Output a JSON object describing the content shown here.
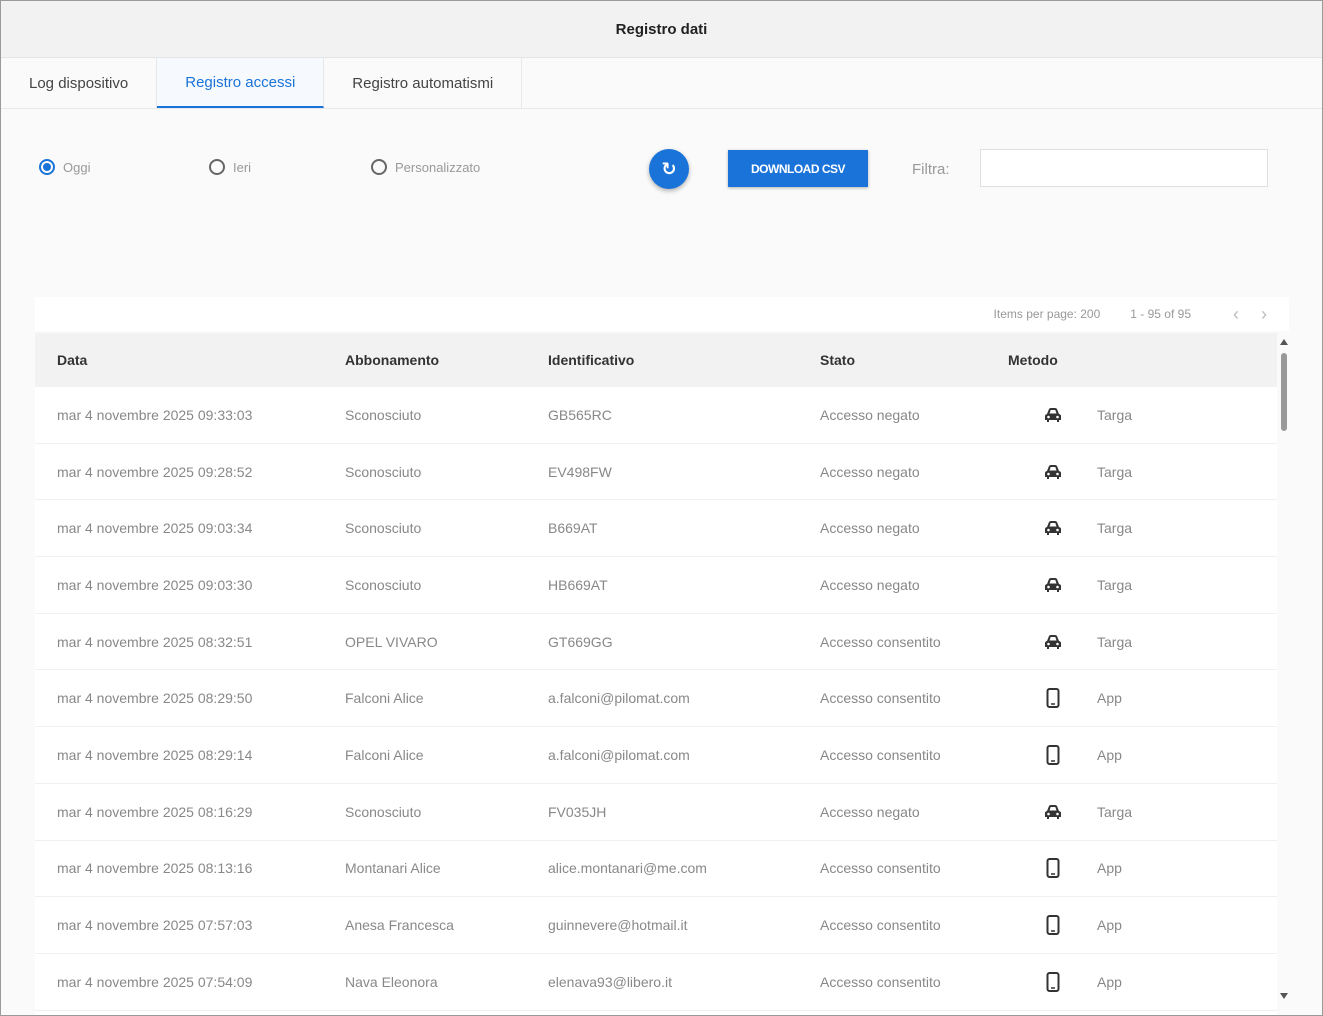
{
  "window": {
    "title": "Registro dati"
  },
  "tabs": [
    {
      "label": "Log dispositivo",
      "active": false
    },
    {
      "label": "Registro accessi",
      "active": true
    },
    {
      "label": "Registro automatismi",
      "active": false
    }
  ],
  "filters": {
    "radios": [
      {
        "label": "Oggi",
        "checked": true
      },
      {
        "label": "Ieri",
        "checked": false
      },
      {
        "label": "Personalizzato",
        "checked": false
      }
    ],
    "download_label": "DOWNLOAD CSV",
    "filter_label": "Filtra:",
    "filter_value": ""
  },
  "pager": {
    "items_per_page": "Items per page: 200",
    "range": "1 - 95 of 95"
  },
  "table": {
    "headers": [
      "Data",
      "Abbonamento",
      "Identificativo",
      "Stato",
      "Metodo"
    ],
    "rows": [
      {
        "data": "mar 4 novembre 2025 09:33:03",
        "abbonamento": "Sconosciuto",
        "identificativo": "GB565RC",
        "stato": "Accesso negato",
        "icon": "car-icon",
        "metodo": "Targa"
      },
      {
        "data": "mar 4 novembre 2025 09:28:52",
        "abbonamento": "Sconosciuto",
        "identificativo": "EV498FW",
        "stato": "Accesso negato",
        "icon": "car-icon",
        "metodo": "Targa"
      },
      {
        "data": "mar 4 novembre 2025 09:03:34",
        "abbonamento": "Sconosciuto",
        "identificativo": "B669AT",
        "stato": "Accesso negato",
        "icon": "car-icon",
        "metodo": "Targa"
      },
      {
        "data": "mar 4 novembre 2025 09:03:30",
        "abbonamento": "Sconosciuto",
        "identificativo": "HB669AT",
        "stato": "Accesso negato",
        "icon": "car-icon",
        "metodo": "Targa"
      },
      {
        "data": "mar 4 novembre 2025 08:32:51",
        "abbonamento": "OPEL VIVARO",
        "identificativo": "GT669GG",
        "stato": "Accesso consentito",
        "icon": "car-icon",
        "metodo": "Targa"
      },
      {
        "data": "mar 4 novembre 2025 08:29:50",
        "abbonamento": "Falconi Alice",
        "identificativo": "a.falconi@pilomat.com",
        "stato": "Accesso consentito",
        "icon": "phone-icon",
        "metodo": "App"
      },
      {
        "data": "mar 4 novembre 2025 08:29:14",
        "abbonamento": "Falconi Alice",
        "identificativo": "a.falconi@pilomat.com",
        "stato": "Accesso consentito",
        "icon": "phone-icon",
        "metodo": "App"
      },
      {
        "data": "mar 4 novembre 2025 08:16:29",
        "abbonamento": "Sconosciuto",
        "identificativo": "FV035JH",
        "stato": "Accesso negato",
        "icon": "car-icon",
        "metodo": "Targa"
      },
      {
        "data": "mar 4 novembre 2025 08:13:16",
        "abbonamento": "Montanari Alice",
        "identificativo": "alice.montanari@me.com",
        "stato": "Accesso consentito",
        "icon": "phone-icon",
        "metodo": "App"
      },
      {
        "data": "mar 4 novembre 2025 07:57:03",
        "abbonamento": "Anesa Francesca",
        "identificativo": "guinnevere@hotmail.it",
        "stato": "Accesso consentito",
        "icon": "phone-icon",
        "metodo": "App"
      },
      {
        "data": "mar 4 novembre 2025 07:54:09",
        "abbonamento": "Nava Eleonora",
        "identificativo": "elenava93@libero.it",
        "stato": "Accesso consentito",
        "icon": "phone-icon",
        "metodo": "App"
      }
    ]
  },
  "colors": {
    "accent": "#1a73d9"
  }
}
